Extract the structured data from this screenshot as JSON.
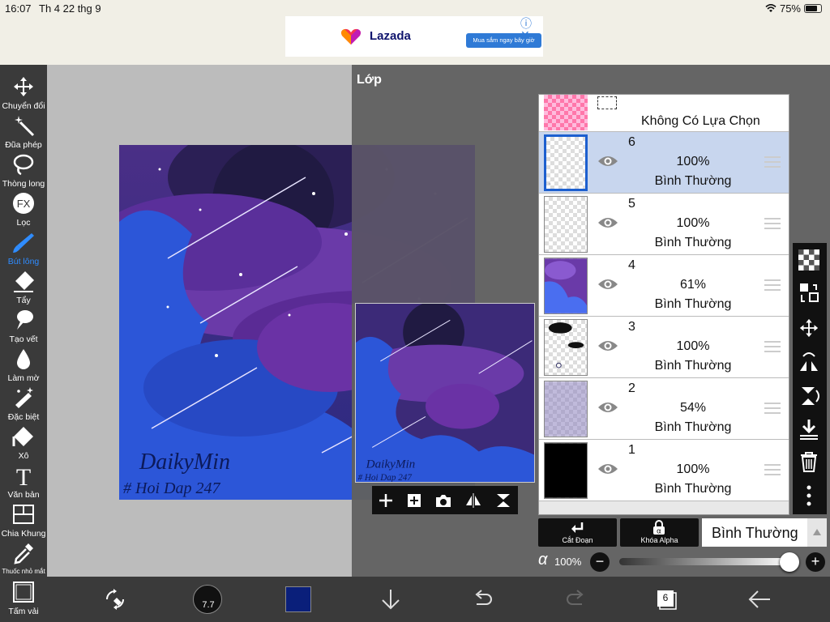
{
  "status": {
    "time": "16:07",
    "date": "Th 4 22 thg 9",
    "battery": "75%",
    "battery_level": 0.75
  },
  "ad": {
    "brand": "Lazada",
    "cta": "Mua sắm ngay bây giờ"
  },
  "toolbar": {
    "items": [
      {
        "label": "Chuyển đổi",
        "icon": "move-icon"
      },
      {
        "label": "Đũa phép",
        "icon": "magic-wand-icon"
      },
      {
        "label": "Thòng long",
        "icon": "lasso-icon"
      },
      {
        "label": "Lọc",
        "icon": "fx-filter-icon",
        "glyph": "FX"
      },
      {
        "label": "Bút lông",
        "icon": "brush-icon"
      },
      {
        "label": "Tẩy",
        "icon": "eraser-icon"
      },
      {
        "label": "Tạo vết",
        "icon": "smudge-icon"
      },
      {
        "label": "Làm mờ",
        "icon": "blur-drop-icon"
      },
      {
        "label": "Đặc biệt",
        "icon": "special-brush-icon"
      },
      {
        "label": "Xô",
        "icon": "fill-bucket-icon"
      },
      {
        "label": "Văn bản",
        "icon": "text-icon",
        "glyph": "T"
      },
      {
        "label": "Chia Khung",
        "icon": "frame-divider-icon"
      },
      {
        "label": "Thuốc nhỏ mắt",
        "icon": "eyedropper-icon"
      },
      {
        "label": "Tấm vải",
        "icon": "canvas-icon"
      }
    ],
    "active_index": 4,
    "active_color": "#2f8cff"
  },
  "artwork": {
    "signature_line1": "DaikyMin",
    "signature_line2": "# Hoi Dap 247"
  },
  "panel": {
    "title": "Lớp",
    "selection_label": "Không Có Lựa Chọn",
    "layers": [
      {
        "number": "6",
        "opacity": "100%",
        "mode": "Bình Thường",
        "selected": true
      },
      {
        "number": "5",
        "opacity": "100%",
        "mode": "Bình Thường",
        "selected": false
      },
      {
        "number": "4",
        "opacity": "61%",
        "mode": "Bình Thường",
        "selected": false
      },
      {
        "number": "3",
        "opacity": "100%",
        "mode": "Bình Thường",
        "selected": false
      },
      {
        "number": "2",
        "opacity": "54%",
        "mode": "Bình Thường",
        "selected": false
      },
      {
        "number": "1",
        "opacity": "100%",
        "mode": "Bình Thường",
        "selected": false
      }
    ],
    "clip_label": "Cắt Đoạn",
    "alpha_lock_label": "Khóa Alpha",
    "alpha_lock_glyph": "α",
    "blend_mode": "Bình Thường",
    "alpha_symbol": "α",
    "alpha_value": "100%",
    "alpha_level": 1.0
  },
  "bottombar": {
    "brush_size": "7.7",
    "layer_count": "6",
    "color": "#0a1f7a"
  },
  "colors": {
    "toolbar": "#3a3a3a",
    "panel": "#606060",
    "selected_layer": "#c8d6ee",
    "accent": "#1c5fcf"
  }
}
